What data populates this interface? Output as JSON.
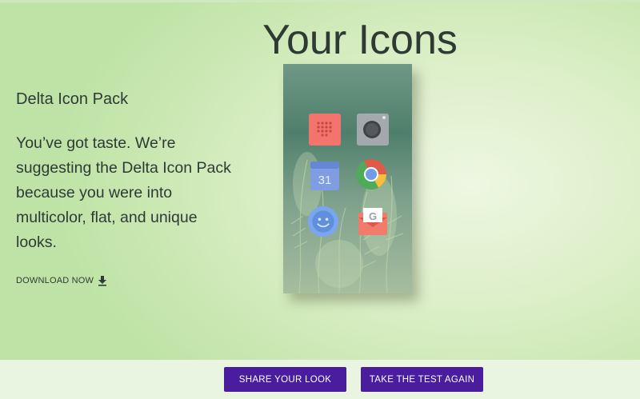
{
  "page": {
    "title": "Your Icons"
  },
  "pack": {
    "name": "Delta Icon Pack",
    "description": "You’ve got taste. We’re suggesting the Delta Icon Pack because you were into multicolor, flat, and unique looks.",
    "download_label": "DOWNLOAD NOW",
    "download_icon": "download-icon"
  },
  "preview": {
    "icons": [
      {
        "name": "dialer-app-icon",
        "color": "#f2746c"
      },
      {
        "name": "camera-app-icon",
        "color": "#9ea3a8"
      },
      {
        "name": "calendar-app-icon",
        "color": "#7f9de0",
        "label": "31"
      },
      {
        "name": "chrome-app-icon",
        "color": "#e05a4a"
      },
      {
        "name": "face-app-icon",
        "color": "#7aa6ef"
      },
      {
        "name": "gmail-app-icon",
        "color": "#f27b6b"
      }
    ]
  },
  "actions": {
    "share_label": "SHARE YOUR LOOK",
    "retake_label": "TAKE THE TEST AGAIN"
  },
  "colors": {
    "button": "#4a1c9e",
    "background": "#d8edc4"
  }
}
